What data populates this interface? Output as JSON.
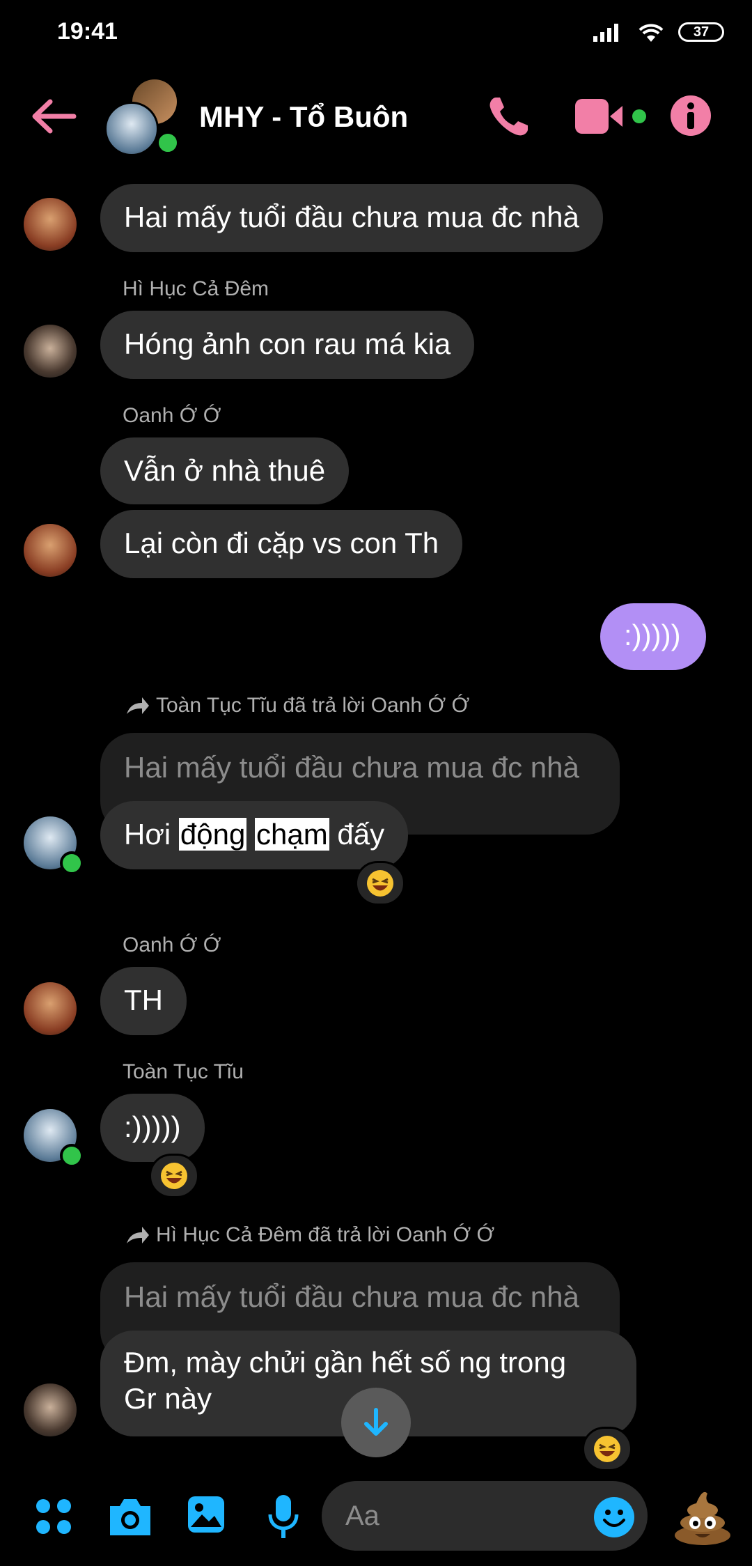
{
  "status": {
    "time": "19:41",
    "battery": "37"
  },
  "header": {
    "title": "MHY -  Tổ Buôn"
  },
  "messages": {
    "m1": {
      "text": "Hai mấy tuổi đầu chưa mua đc nhà"
    },
    "m2": {
      "sender": "Hì Hục Cả Đêm",
      "text": "Hóng ảnh con rau má kia"
    },
    "m3": {
      "sender": "Oanh Ớ Ớ",
      "text1": "Vẫn ở nhà thuê",
      "text2": "Lại còn đi cặp vs con Th"
    },
    "m4": {
      "text": ":)))))"
    },
    "m5": {
      "reply_note": "Toàn Tục Tĩu đã trả lời Oanh Ớ Ớ",
      "quoted": "Hai mấy tuổi đầu chưa mua đc nhà",
      "w1": "Hơi",
      "w2": "động",
      "w3": "chạm",
      "w4": "đấy"
    },
    "m6": {
      "sender": "Oanh Ớ Ớ",
      "text": "TH"
    },
    "m7": {
      "sender": "Toàn Tục Tĩu",
      "text": ":)))))"
    },
    "m8": {
      "reply_note": "Hì Hục Cả Đêm đã trả lời Oanh Ớ Ớ",
      "quoted": "Hai mấy tuổi đầu chưa mua đc nhà",
      "line1": "Đm, mày chửi gần hết số ng trong",
      "line2": "Gr này"
    }
  },
  "composer": {
    "placeholder": "Aa"
  },
  "icons": {
    "back": "arrow-left-icon",
    "call": "phone-icon",
    "video": "video-camera-icon",
    "info": "info-icon",
    "menu": "four-dots-icon",
    "camera": "camera-icon",
    "gallery": "image-icon",
    "mic": "microphone-icon",
    "emoji": "smiley-icon",
    "poop": "poop-emoji-icon",
    "reaction": "laughing-emoji-icon",
    "scroll": "arrow-down-icon"
  },
  "colors": {
    "accent_pink": "#f27fa7",
    "accent_blue": "#1fb6ff",
    "own_bubble": "#b28ff5",
    "online": "#31c44a"
  }
}
